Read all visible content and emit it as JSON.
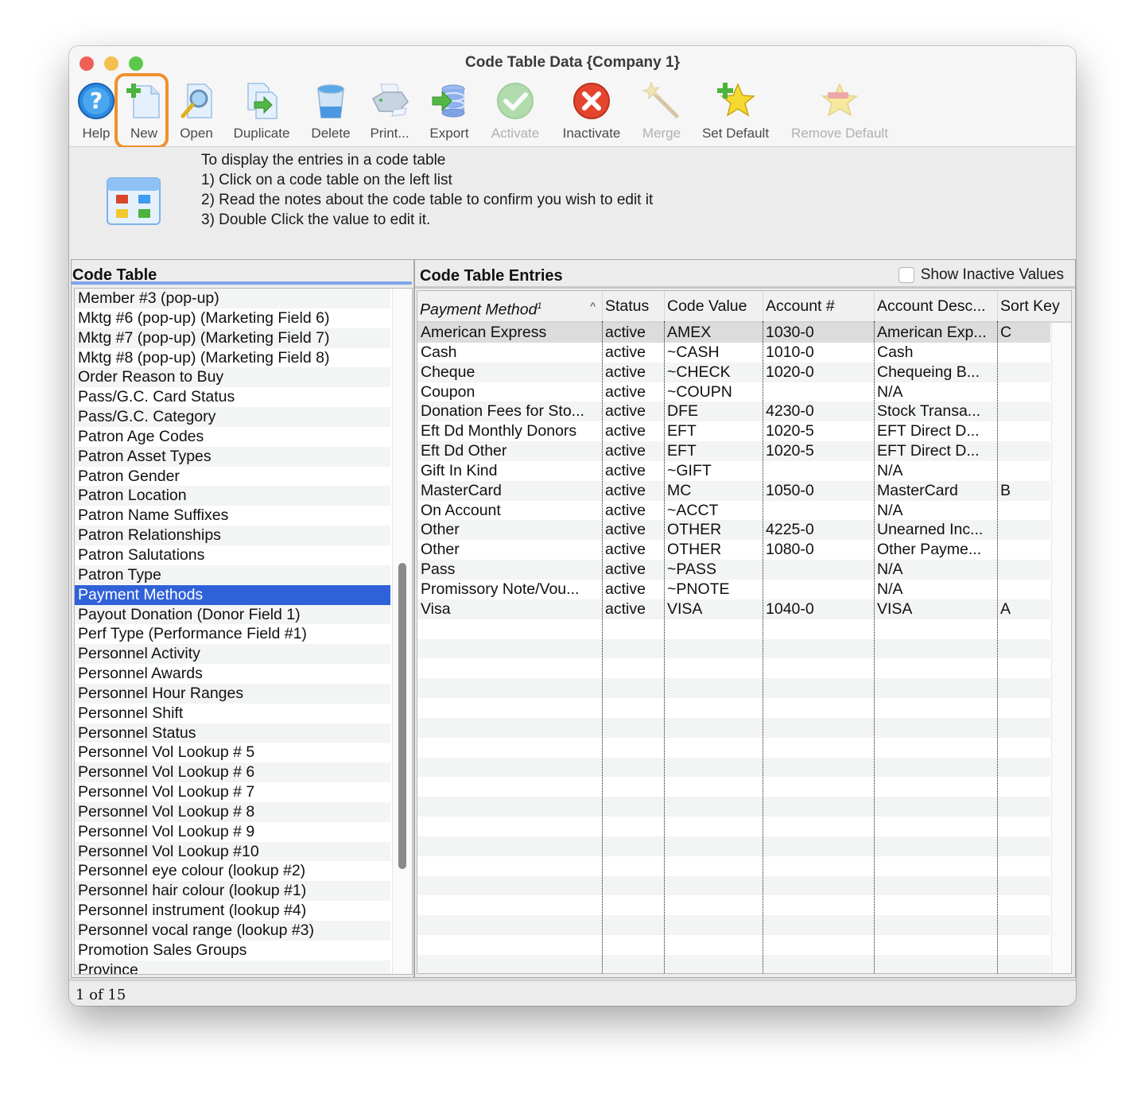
{
  "window": {
    "title": "Code Table Data {Company 1}"
  },
  "toolbar": {
    "buttons": [
      {
        "id": "help",
        "label": "Help",
        "icon": "help-icon",
        "enabled": true
      },
      {
        "id": "new",
        "label": "New",
        "icon": "new-document-icon",
        "enabled": true,
        "highlighted": true
      },
      {
        "id": "open",
        "label": "Open",
        "icon": "open-magnifier-icon",
        "enabled": true
      },
      {
        "id": "duplicate",
        "label": "Duplicate",
        "icon": "duplicate-icon",
        "enabled": true
      },
      {
        "id": "delete",
        "label": "Delete",
        "icon": "trash-can-icon",
        "enabled": true
      },
      {
        "id": "print",
        "label": "Print...",
        "icon": "printer-icon",
        "enabled": true
      },
      {
        "id": "export",
        "label": "Export",
        "icon": "export-database-icon",
        "enabled": true
      },
      {
        "id": "activate",
        "label": "Activate",
        "icon": "checkmark-icon",
        "enabled": false
      },
      {
        "id": "inactivate",
        "label": "Inactivate",
        "icon": "x-circle-icon",
        "enabled": true
      },
      {
        "id": "merge",
        "label": "Merge",
        "icon": "magic-wand-icon",
        "enabled": false
      },
      {
        "id": "set_default",
        "label": "Set Default",
        "icon": "star-plus-icon",
        "enabled": true
      },
      {
        "id": "remove_default",
        "label": "Remove Default",
        "icon": "star-minus-icon",
        "enabled": false
      }
    ],
    "highlight_color": "#f0912b"
  },
  "instructions": {
    "lines": [
      "To display the entries in a code table",
      "1) Click on a code table on the left list",
      "2) Read the notes about the code table to confirm you wish to edit it",
      "3) Double Click the value to edit it."
    ]
  },
  "code_table_panel": {
    "heading": "Code Table",
    "selected": "Payment Methods",
    "selection_color": "#2f62d9",
    "items": [
      "Member #3 (pop-up)",
      "Mktg #6 (pop-up) (Marketing Field 6)",
      "Mktg #7 (pop-up) (Marketing Field 7)",
      "Mktg #8 (pop-up) (Marketing Field 8)",
      "Order Reason to Buy",
      "Pass/G.C. Card Status",
      "Pass/G.C. Category",
      "Patron Age Codes",
      "Patron Asset Types",
      "Patron Gender",
      "Patron Location",
      "Patron Name Suffixes",
      "Patron Relationships",
      "Patron Salutations",
      "Patron Type",
      "Payment Methods",
      "Payout Donation (Donor Field 1)",
      "Perf Type (Performance Field #1)",
      "Personnel Activity",
      "Personnel Awards",
      "Personnel Hour Ranges",
      "Personnel Shift",
      "Personnel Status",
      "Personnel Vol Lookup # 5",
      "Personnel Vol Lookup # 6",
      "Personnel Vol Lookup # 7",
      "Personnel Vol Lookup # 8",
      "Personnel Vol Lookup # 9",
      "Personnel Vol Lookup #10",
      "Personnel eye colour (lookup #2)",
      "Personnel hair colour (lookup #1)",
      "Personnel instrument (lookup #4)",
      "Personnel vocal range (lookup #3)",
      "Promotion Sales Groups",
      "Province"
    ]
  },
  "entries_panel": {
    "heading": "Code Table Entries",
    "show_inactive_label": "Show Inactive Values",
    "show_inactive_checked": false,
    "columns": [
      {
        "label": "Payment Method",
        "superscript": "1",
        "sort": "^"
      },
      {
        "label": "Status"
      },
      {
        "label": "Code Value"
      },
      {
        "label": "Account #"
      },
      {
        "label": "Account Desc..."
      },
      {
        "label": "Sort Key"
      }
    ],
    "rows": [
      [
        "American Express",
        "active",
        "AMEX",
        "1030-0",
        "American Exp...",
        "C"
      ],
      [
        "Cash",
        "active",
        "~CASH",
        "1010-0",
        "Cash",
        ""
      ],
      [
        "Cheque",
        "active",
        "~CHECK",
        "1020-0",
        "Chequeing B...",
        ""
      ],
      [
        "Coupon",
        "active",
        "~COUPN",
        "",
        "N/A",
        ""
      ],
      [
        "Donation Fees for Sto...",
        "active",
        "DFE",
        "4230-0",
        "Stock Transa...",
        ""
      ],
      [
        "Eft Dd Monthly Donors",
        "active",
        "EFT",
        "1020-5",
        "EFT Direct D...",
        ""
      ],
      [
        "Eft Dd Other",
        "active",
        "EFT",
        "1020-5",
        "EFT Direct D...",
        ""
      ],
      [
        "Gift In Kind",
        "active",
        "~GIFT",
        "",
        "N/A",
        ""
      ],
      [
        "MasterCard",
        "active",
        "MC",
        "1050-0",
        "MasterCard",
        "B"
      ],
      [
        "On Account",
        "active",
        "~ACCT",
        "",
        "N/A",
        ""
      ],
      [
        "Other",
        "active",
        "OTHER",
        "4225-0",
        "Unearned Inc...",
        ""
      ],
      [
        "Other",
        "active",
        "OTHER",
        "1080-0",
        "Other Payme...",
        ""
      ],
      [
        "Pass",
        "active",
        "~PASS",
        "",
        "N/A",
        ""
      ],
      [
        "Promissory Note/Vou...",
        "active",
        "~PNOTE",
        "",
        "N/A",
        ""
      ],
      [
        "Visa",
        "active",
        "VISA",
        "1040-0",
        "VISA",
        "A"
      ]
    ],
    "selected_row": 0
  },
  "status_bar": {
    "text": "1 of 15"
  }
}
